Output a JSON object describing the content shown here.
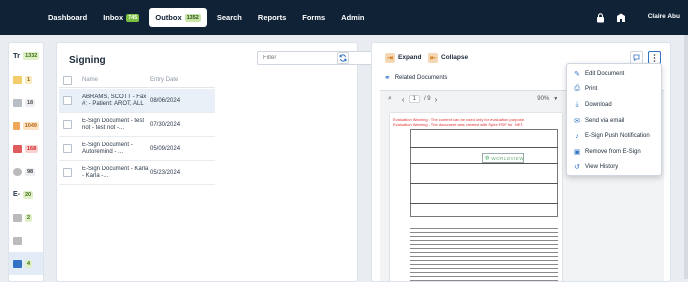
{
  "nav": {
    "items": [
      {
        "label": "Dashboard"
      },
      {
        "label": "Inbox",
        "badge": "745"
      },
      {
        "label": "Outbox",
        "badge": "1352",
        "active": true
      },
      {
        "label": "Search"
      },
      {
        "label": "Reports"
      },
      {
        "label": "Forms"
      },
      {
        "label": "Admin"
      }
    ],
    "user": "Claire Abu"
  },
  "sidebar": {
    "head": {
      "label": "Tr",
      "count": "1332"
    },
    "items": [
      {
        "icon": "document-icon",
        "count": "1",
        "color": "#f3cd6a",
        "bg": "#fbe9c0",
        "txt": "#8a6a10"
      },
      {
        "icon": "folder-icon",
        "count": "18",
        "color": "#b8bec6",
        "bg": "#eceef1",
        "txt": "#555"
      },
      {
        "icon": "folder-icon",
        "count": "1049",
        "color": "#f0a75a",
        "bg": "#fde2c3",
        "txt": "#b66515"
      },
      {
        "icon": "folder-icon",
        "count": "168",
        "color": "#e05b5b",
        "bg": "#fbd0d0",
        "txt": "#c22"
      },
      {
        "icon": "circle-icon",
        "count": "98",
        "color": "#bbb",
        "bg": "#eceef1",
        "txt": "#444"
      },
      {
        "icon": "esign-icon",
        "label": "E-",
        "count": "20",
        "color": "#7cc043",
        "bg": "#dff0c9",
        "txt": "#3b6e12"
      },
      {
        "icon": "inbox-icon",
        "count": "2",
        "color": "#bbb",
        "bg": "#dff0c9",
        "txt": "#3b6e12"
      },
      {
        "icon": "tray-icon",
        "count": "",
        "color": "#bbb",
        "bg": "",
        "txt": ""
      },
      {
        "icon": "signature-icon",
        "count": "4",
        "color": "#3273c4",
        "bg": "#dff0c9",
        "txt": "#3b6e12"
      }
    ]
  },
  "list": {
    "title": "Signing",
    "filter_placeholder": "Filter",
    "columns": [
      "Name",
      "Entry Date"
    ],
    "rows": [
      {
        "name": "ABRAMS, SCOTT - Fax #: - Patient: AROT, ALL",
        "date": "08/06/2024",
        "selected": true
      },
      {
        "name": "E-Sign Document - test not - test not -...",
        "date": "07/30/2024"
      },
      {
        "name": "E-Sign Document - Autoremind - ...",
        "date": "05/09/2024"
      },
      {
        "name": "E-Sign Document - Karla - Karla -...",
        "date": "05/23/2024"
      }
    ]
  },
  "doc": {
    "expand": "Expand",
    "collapse": "Collapse",
    "related": "Related Documents",
    "page_num": "1",
    "page_of": "/ 9",
    "zoom": "90%",
    "warning1": "Evaluation Warning : The content can be used only for evaluation purpose.",
    "warning2": "Evaluation Warning : The document was created with Spire.PDF for .NET.",
    "watermark": "WORLDVIEW"
  },
  "menu": {
    "items": [
      {
        "label": "Edit Document",
        "icon": "edit-icon",
        "glyph": "✎"
      },
      {
        "label": "Print",
        "icon": "print-icon",
        "glyph": "⎙"
      },
      {
        "label": "Download",
        "icon": "download-icon",
        "glyph": "⤓"
      },
      {
        "label": "Send via email",
        "icon": "email-icon",
        "glyph": "✉"
      },
      {
        "label": "E-Sign Push Notification",
        "icon": "bell-icon",
        "glyph": "♪"
      },
      {
        "label": "Remove from E-Sign",
        "icon": "remove-icon",
        "glyph": "▣"
      },
      {
        "label": "View History",
        "icon": "history-icon",
        "glyph": "↺"
      }
    ]
  }
}
